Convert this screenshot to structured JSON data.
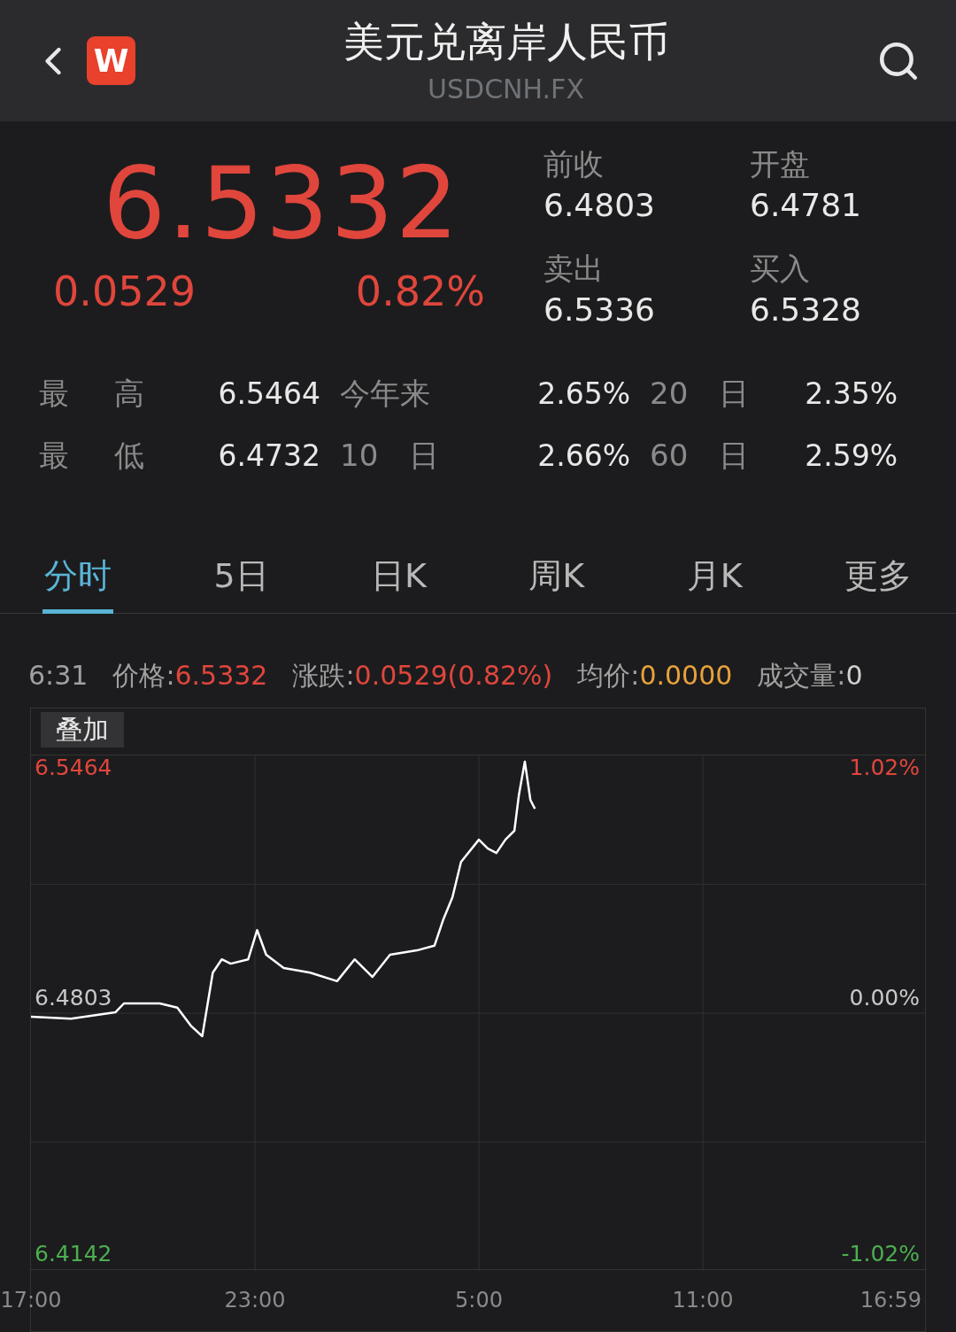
{
  "header": {
    "title": "美元兑离岸人民币",
    "subtitle": "USDCNH.FX",
    "logo_text": "W"
  },
  "quote": {
    "price": "6.5332",
    "change": "0.0529",
    "change_pct": "0.82%",
    "fields": [
      {
        "label": "前收",
        "value": "6.4803"
      },
      {
        "label": "开盘",
        "value": "6.4781"
      },
      {
        "label": "卖出",
        "value": "6.5336"
      },
      {
        "label": "买入",
        "value": "6.5328"
      }
    ]
  },
  "stats": [
    [
      {
        "label": "最 高",
        "value": "6.5464"
      },
      {
        "label": "今年来",
        "value": "2.65%"
      },
      {
        "label": "20 日",
        "value": "2.35%"
      }
    ],
    [
      {
        "label": "最 低",
        "value": "6.4732"
      },
      {
        "label": "10 日",
        "value": "2.66%"
      },
      {
        "label": "60 日",
        "value": "2.59%"
      }
    ]
  ],
  "tabs": [
    {
      "label": "分时",
      "selected": true
    },
    {
      "label": "5日",
      "selected": false
    },
    {
      "label": "日K",
      "selected": false
    },
    {
      "label": "周K",
      "selected": false
    },
    {
      "label": "月K",
      "selected": false
    },
    {
      "label": "更多",
      "selected": false
    }
  ],
  "info": {
    "time": "6:31",
    "items": [
      {
        "label": "价格:",
        "value": "6.5332",
        "color": "#e0463c"
      },
      {
        "label": "涨跌:",
        "value": "0.0529(0.82%)",
        "color": "#e0463c"
      },
      {
        "label": "均价:",
        "value": "0.0000",
        "color": "#e8a23a"
      },
      {
        "label": "成交量:",
        "value": "0",
        "color": "#d0d0d0"
      }
    ]
  },
  "chart": {
    "overlay_button": "叠加",
    "right_labels": [
      "1.02%",
      "0.00%",
      "-1.02%"
    ],
    "later_time_labels": [
      "5:00",
      "11:00",
      "16:59"
    ],
    "max_price_label": "6.5464",
    "chart_data": {
      "type": "line",
      "x": [
        17,
        18.07,
        19.26,
        19.49,
        20.45,
        20.92,
        21.28,
        21.59,
        21.87,
        22.11,
        22.35,
        22.82,
        23.06,
        23.3,
        23.77,
        24.48,
        25.2,
        25.67,
        26.15,
        26.62,
        27.34,
        27.81,
        28.05,
        28.29,
        28.52,
        29,
        29.24,
        29.47,
        29.71,
        29.95,
        30.07,
        30.23,
        30.38,
        30.5
      ],
      "series": [
        {
          "color": "#ffffff",
          "values": [
            6.4794,
            6.4789,
            6.4805,
            6.4828,
            6.4828,
            6.4817,
            6.4771,
            6.4744,
            6.4907,
            6.4941,
            6.493,
            6.4941,
            6.5016,
            6.4953,
            6.4919,
            6.4907,
            6.4885,
            6.4941,
            6.4896,
            6.4953,
            6.4964,
            6.4976,
            6.5044,
            6.51,
            6.5191,
            6.5248,
            6.5225,
            6.5214,
            6.5248,
            6.5271,
            6.5361,
            6.5448,
            6.535,
            6.5327
          ]
        }
      ],
      "xlim": [
        17,
        41
      ],
      "ylim": [
        6.4142,
        6.5464
      ],
      "xticks": [
        {
          "value": 17,
          "label": "17:00"
        },
        {
          "value": 23,
          "label": "23:00"
        }
      ],
      "yticks": [
        {
          "value": 6.4142,
          "label": "6.4142"
        },
        {
          "value": 6.4803,
          "label": "6.4803"
        }
      ]
    }
  }
}
